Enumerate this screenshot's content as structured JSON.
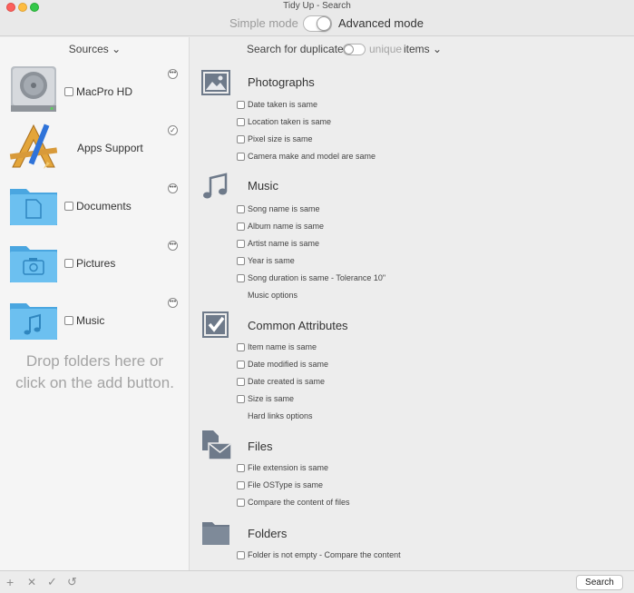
{
  "window": {
    "title": "Tidy Up - Search"
  },
  "mode": {
    "simple_label": "Simple mode",
    "advanced_label": "Advanced mode",
    "selected": "advanced"
  },
  "sidebar": {
    "header": "Sources ⌄",
    "sources": [
      {
        "label": "MacPro HD",
        "icon": "hard-drive-icon",
        "action": "more"
      },
      {
        "label": "Apps Support",
        "icon": "applications-icon",
        "action": "check"
      },
      {
        "label": "Documents",
        "icon": "documents-folder-icon",
        "action": "more"
      },
      {
        "label": "Pictures",
        "icon": "pictures-folder-icon",
        "action": "more"
      },
      {
        "label": "Music",
        "icon": "music-folder-icon",
        "action": "more"
      }
    ],
    "drop_line1": "Drop folders here or",
    "drop_line2": "click on the add button."
  },
  "search_for": {
    "prefix": "Search for duplicate",
    "unique": "unique",
    "items": "items ⌄",
    "unique_on": false
  },
  "sections": {
    "photographs": {
      "title": "Photographs",
      "icon": "photo-icon",
      "options": [
        "Date taken is same",
        "Location taken is same",
        "Pixel size is same",
        "Camera make and model are same"
      ]
    },
    "music": {
      "title": "Music",
      "icon": "music-note-icon",
      "options": [
        "Song name is same",
        "Album name is same",
        "Artist name is same",
        "Year is same",
        "Song duration is same - Tolerance 10\""
      ],
      "link": "Music options"
    },
    "common": {
      "title": "Common Attributes",
      "icon": "checkbox-icon",
      "options": [
        "Item name is same",
        "Date modified is same",
        "Date created is same",
        "Size is same"
      ],
      "link": "Hard links options"
    },
    "files": {
      "title": "Files",
      "icon": "files-icon",
      "options": [
        "File extension is same",
        "File OSType is same",
        "Compare the content of files"
      ]
    },
    "folders": {
      "title": "Folders",
      "icon": "folder-icon",
      "options": [
        "Folder is not empty - Compare the content"
      ]
    }
  },
  "bottom": {
    "add": "+",
    "remove": "✕",
    "apply": "✓",
    "reset": "↺",
    "search_label": "Search"
  },
  "colors": {
    "folder": "#5fb8ec",
    "section_icon": "#6e7a8a",
    "sidebar_bg": "#f5f5f5",
    "main_bg": "#ededed"
  }
}
